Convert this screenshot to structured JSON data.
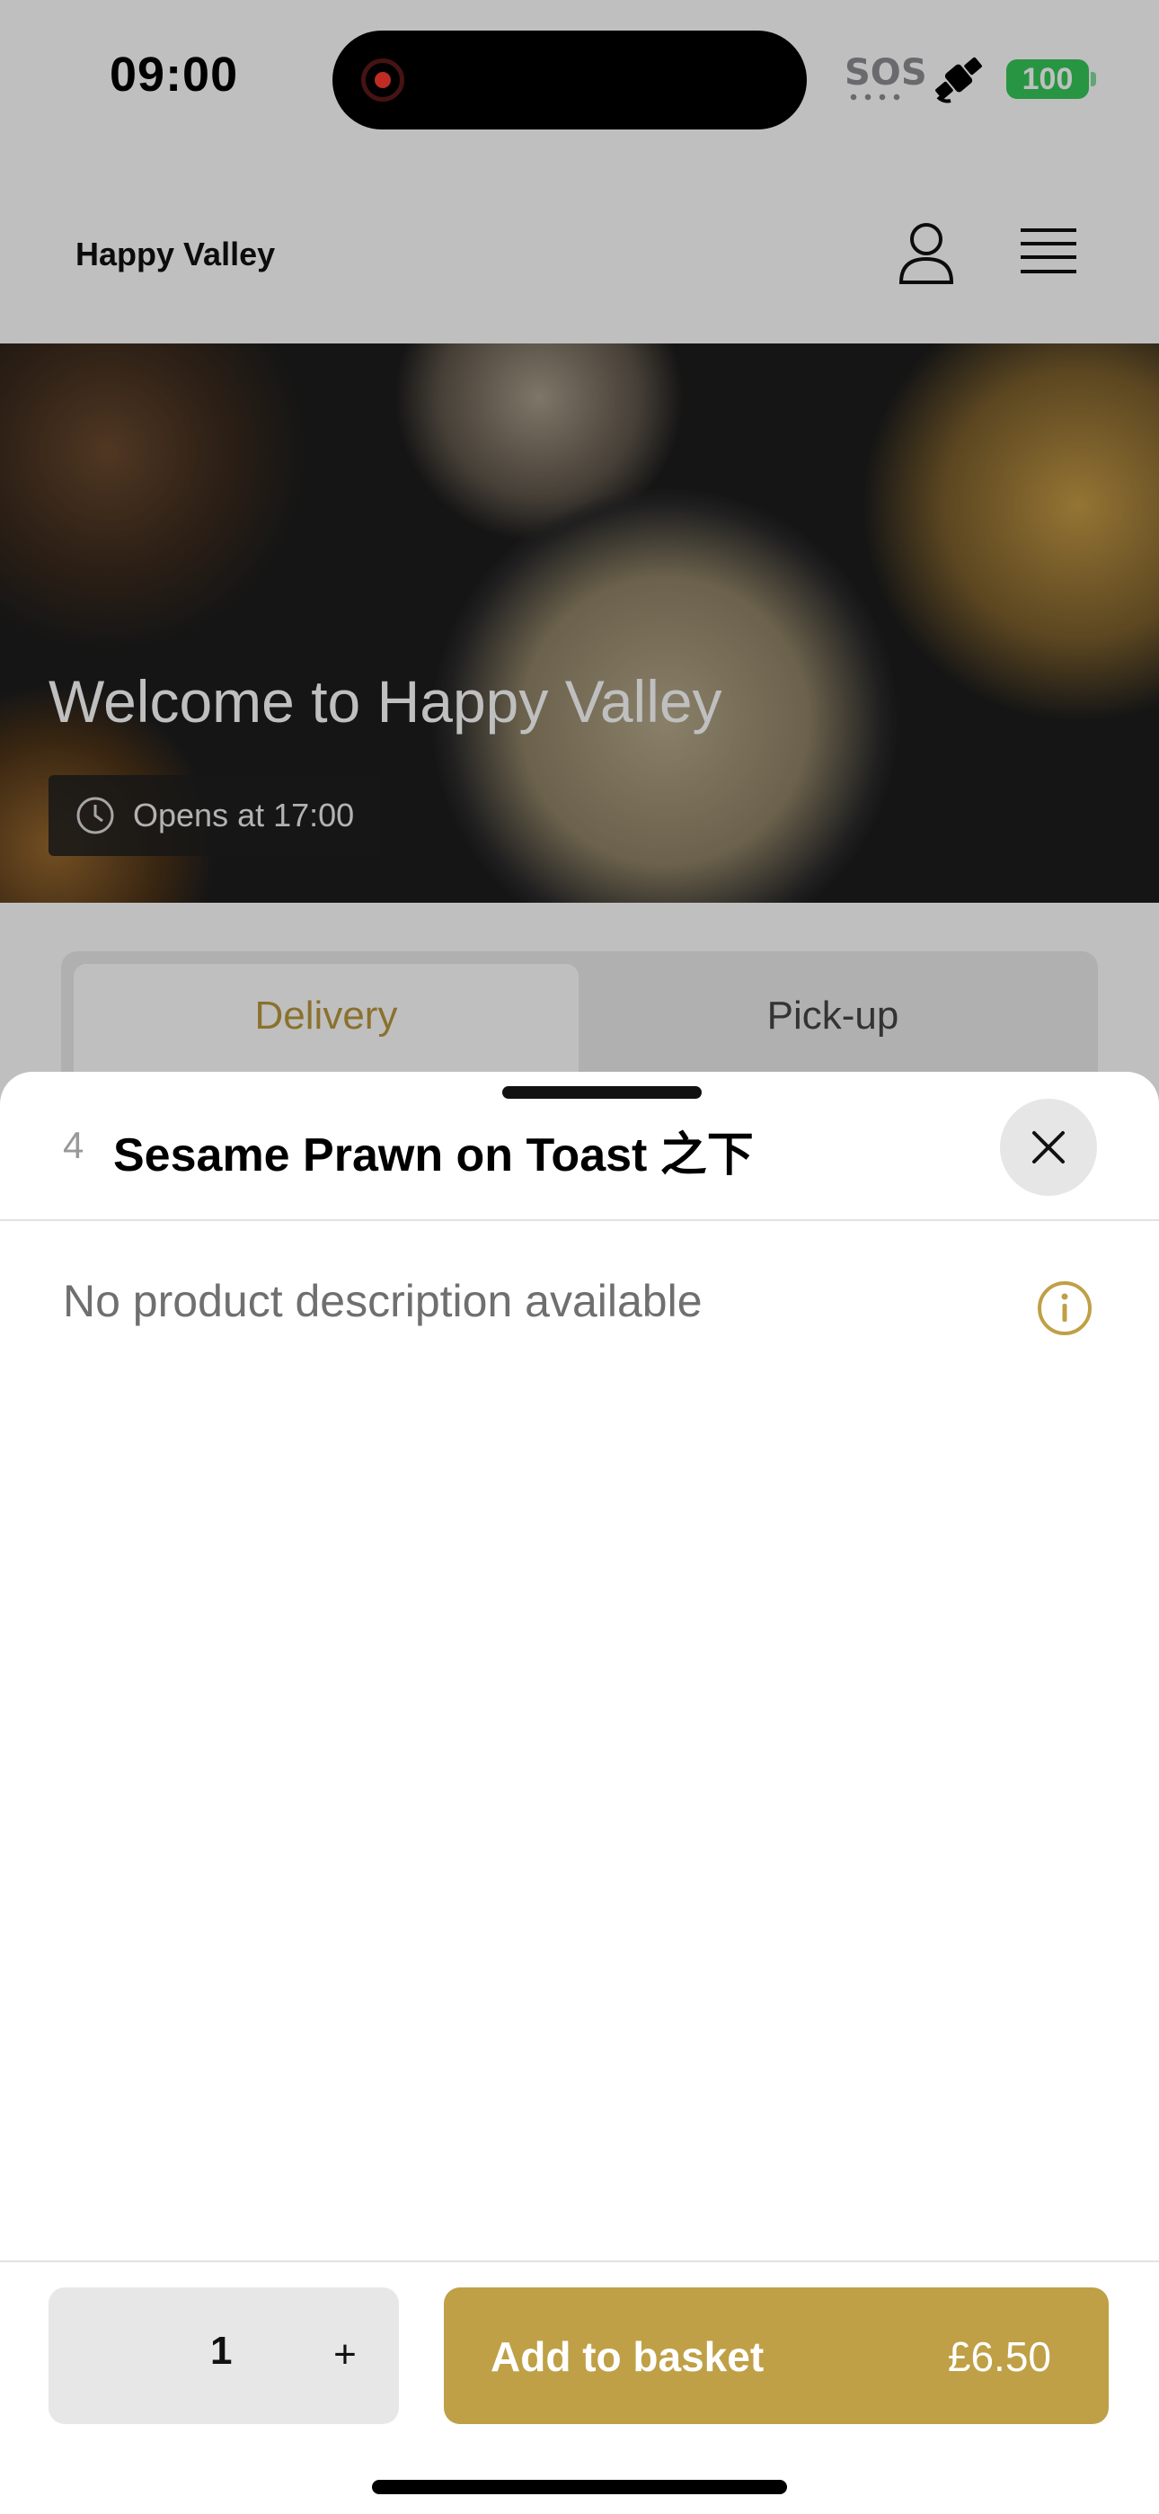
{
  "status_bar": {
    "time": "09:00",
    "sos": "SOS",
    "battery": "100",
    "icons": [
      "record-indicator-icon",
      "satellite-icon",
      "battery-icon"
    ]
  },
  "header": {
    "brand": "Happy Valley",
    "icons": [
      "user-icon",
      "menu-icon"
    ]
  },
  "hero": {
    "title": "Welcome to Happy Valley",
    "opening": "Opens at 17:00",
    "icon": "clock-icon"
  },
  "mode_tabs": {
    "items": [
      {
        "label": "Delivery",
        "selected": true
      },
      {
        "label": "Pick-up",
        "selected": false
      }
    ]
  },
  "sheet": {
    "item_number": "4",
    "title": "Sesame Prawn on Toast 之下",
    "description": "No product description available",
    "quantity": "1",
    "plus_label": "+",
    "add_label": "Add to basket",
    "price": "£6.50",
    "icons": [
      "close-icon",
      "info-icon"
    ]
  },
  "colors": {
    "accent": "#bfa046",
    "tab_selected_text": "#b8973d",
    "battery": "#34c759"
  }
}
